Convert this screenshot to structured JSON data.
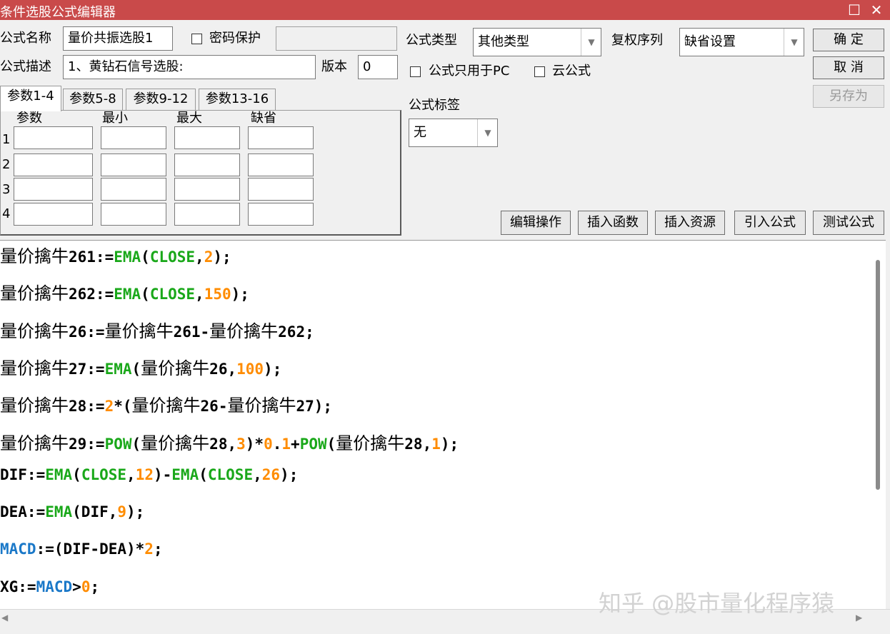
{
  "window": {
    "title": "条件选股公式编辑器",
    "max_glyph": "☐",
    "close_glyph": "✕"
  },
  "form": {
    "name_label": "公式名称",
    "name_value": "量价共振选股1",
    "password_label": "密码保护",
    "password_value": "",
    "desc_label": "公式描述",
    "desc_value": "1、黄钻石信号选股:",
    "version_label": "版本",
    "version_value": "0",
    "type_label": "公式类型",
    "type_value": "其他类型",
    "rights_label": "复权序列",
    "rights_value": "缺省设置",
    "pc_only_label": "公式只用于PC",
    "cloud_label": "云公式",
    "tag_label": "公式标签",
    "tag_value": "无"
  },
  "buttons": {
    "ok": "确 定",
    "cancel": "取 消",
    "save_as": "另存为",
    "edit_ops": "编辑操作",
    "insert_func": "插入函数",
    "insert_res": "插入资源",
    "import_formula": "引入公式",
    "test_formula": "测试公式"
  },
  "tabs": [
    "参数1-4",
    "参数5-8",
    "参数9-12",
    "参数13-16"
  ],
  "params": {
    "headers": [
      "参数",
      "最小",
      "最大",
      "缺省"
    ],
    "rows": [
      "1",
      "2",
      "3",
      "4"
    ]
  },
  "code": [
    [
      {
        "t": "量价擒牛",
        "c": "cj"
      },
      {
        "t": "261:="
      },
      {
        "t": "EMA",
        "c": "fn"
      },
      {
        "t": "("
      },
      {
        "t": "CLOSE",
        "c": "fn"
      },
      {
        "t": ","
      },
      {
        "t": "2",
        "c": "num"
      },
      {
        "t": ");"
      }
    ],
    [
      {
        "t": "量价擒牛",
        "c": "cj"
      },
      {
        "t": "262:="
      },
      {
        "t": "EMA",
        "c": "fn"
      },
      {
        "t": "("
      },
      {
        "t": "CLOSE",
        "c": "fn"
      },
      {
        "t": ","
      },
      {
        "t": "150",
        "c": "num"
      },
      {
        "t": ");"
      }
    ],
    [
      {
        "t": "量价擒牛",
        "c": "cj"
      },
      {
        "t": "26:="
      },
      {
        "t": "量价擒牛",
        "c": "cj"
      },
      {
        "t": "261-"
      },
      {
        "t": "量价擒牛",
        "c": "cj"
      },
      {
        "t": "262;"
      }
    ],
    [
      {
        "t": "量价擒牛",
        "c": "cj"
      },
      {
        "t": "27:="
      },
      {
        "t": "EMA",
        "c": "fn"
      },
      {
        "t": "("
      },
      {
        "t": "量价擒牛",
        "c": "cj"
      },
      {
        "t": "26,"
      },
      {
        "t": "100",
        "c": "num"
      },
      {
        "t": ");"
      }
    ],
    [
      {
        "t": "量价擒牛",
        "c": "cj"
      },
      {
        "t": "28:="
      },
      {
        "t": "2",
        "c": "num"
      },
      {
        "t": "*("
      },
      {
        "t": "量价擒牛",
        "c": "cj"
      },
      {
        "t": "26-"
      },
      {
        "t": "量价擒牛",
        "c": "cj"
      },
      {
        "t": "27);"
      }
    ],
    [
      {
        "t": "量价擒牛",
        "c": "cj"
      },
      {
        "t": "29:="
      },
      {
        "t": "POW",
        "c": "fn"
      },
      {
        "t": "("
      },
      {
        "t": "量价擒牛",
        "c": "cj"
      },
      {
        "t": "28,"
      },
      {
        "t": "3",
        "c": "num"
      },
      {
        "t": ")*"
      },
      {
        "t": "0",
        "c": "num"
      },
      {
        "t": "."
      },
      {
        "t": "1",
        "c": "num"
      },
      {
        "t": "+"
      },
      {
        "t": "POW",
        "c": "fn"
      },
      {
        "t": "("
      },
      {
        "t": "量价擒牛",
        "c": "cj"
      },
      {
        "t": "28,"
      },
      {
        "t": "1",
        "c": "num"
      },
      {
        "t": ");"
      }
    ],
    [
      {
        "t": "DIF:="
      },
      {
        "t": "EMA",
        "c": "fn"
      },
      {
        "t": "("
      },
      {
        "t": "CLOSE",
        "c": "fn"
      },
      {
        "t": ","
      },
      {
        "t": "12",
        "c": "num"
      },
      {
        "t": ")-"
      },
      {
        "t": "EMA",
        "c": "fn"
      },
      {
        "t": "("
      },
      {
        "t": "CLOSE",
        "c": "fn"
      },
      {
        "t": ","
      },
      {
        "t": "26",
        "c": "num"
      },
      {
        "t": ");"
      }
    ],
    [
      {
        "t": "DEA:="
      },
      {
        "t": "EMA",
        "c": "fn"
      },
      {
        "t": "(DIF,"
      },
      {
        "t": "9",
        "c": "num"
      },
      {
        "t": ");"
      }
    ],
    [
      {
        "t": "MACD",
        "c": "var"
      },
      {
        "t": ":=(DIF-DEA)*"
      },
      {
        "t": "2",
        "c": "num"
      },
      {
        "t": ";"
      }
    ],
    [
      {
        "t": "XG:="
      },
      {
        "t": "MACD",
        "c": "var"
      },
      {
        "t": ">"
      },
      {
        "t": "0",
        "c": "num"
      },
      {
        "t": ";"
      }
    ]
  ],
  "watermark": "知乎 @股市量化程序猿",
  "scroll": {
    "left": "◀",
    "right": "▶"
  }
}
